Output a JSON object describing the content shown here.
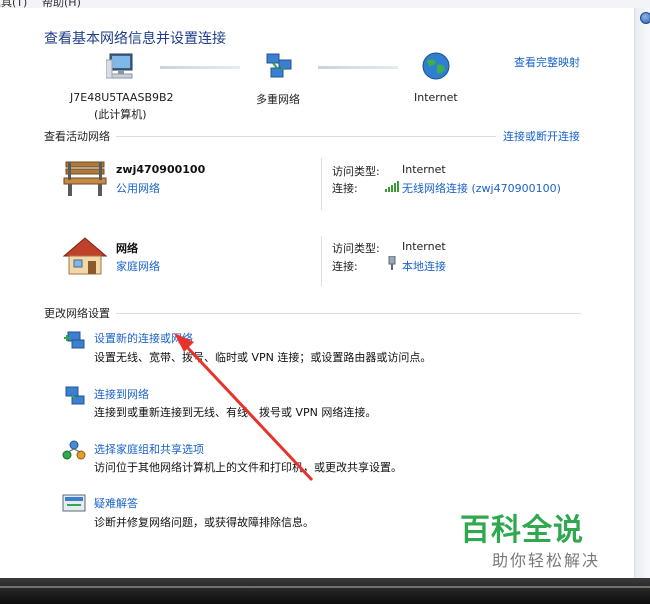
{
  "menubar": {
    "items": [
      "工具(T)",
      "帮助(H)"
    ]
  },
  "page": {
    "title": "查看基本网络信息并设置连接",
    "full_map_link": "查看完整映射"
  },
  "map": {
    "computer_name": "J7E48U5TAASB9B2",
    "computer_sub": "(此计算机)",
    "multi_network": "多重网络",
    "internet": "Internet"
  },
  "active": {
    "section_label": "查看活动网络",
    "connect_link": "连接或断开连接",
    "networks": [
      {
        "name": "zwj470900100",
        "type": "公用网络",
        "access_label": "访问类型:",
        "access_value": "Internet",
        "conn_label": "连接:",
        "conn_value": "无线网络连接 (zwj470900100)"
      },
      {
        "name": "网络",
        "type": "家庭网络",
        "access_label": "访问类型:",
        "access_value": "Internet",
        "conn_label": "连接:",
        "conn_value": "本地连接"
      }
    ]
  },
  "change": {
    "section_label": "更改网络设置",
    "tasks": [
      {
        "title": "设置新的连接或网络",
        "desc": "设置无线、宽带、拨号、临时或 VPN 连接；或设置路由器或访问点。"
      },
      {
        "title": "连接到网络",
        "desc": "连接到或重新连接到无线、有线、拨号或 VPN 网络连接。"
      },
      {
        "title": "选择家庭组和共享选项",
        "desc": "访问位于其他网络计算机上的文件和打印机，或更改共享设置。"
      },
      {
        "title": "疑难解答",
        "desc": "诊断并修复网络问题，或获得故障排除信息。"
      }
    ]
  },
  "watermark": {
    "main": "百科全说",
    "sub": "助你轻松解决"
  },
  "colors": {
    "link": "#1a63c9",
    "title": "#1e3d8a",
    "arrow": "#e8322c",
    "watermark": "#2fa84f"
  }
}
